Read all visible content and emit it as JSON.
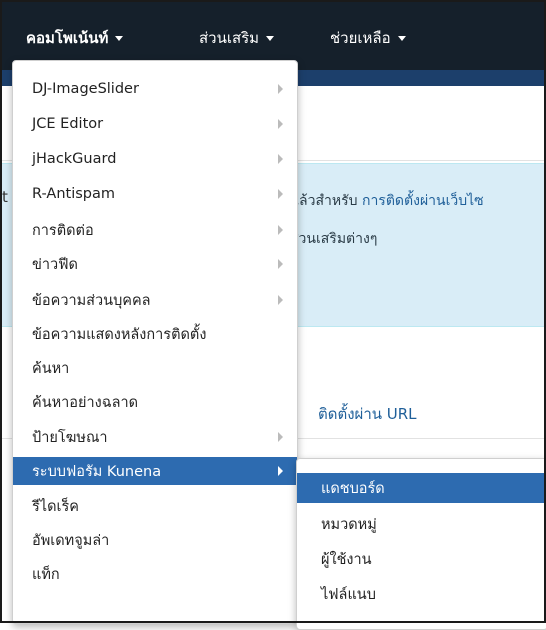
{
  "navbar": {
    "items": [
      {
        "label": "คอมโพเน้นท์"
      },
      {
        "label": "ส่วนเสริม"
      },
      {
        "label": "ช่วยเหลือ"
      }
    ]
  },
  "background": {
    "info_text_1": "แล้วสำหรับ",
    "info_link_1": "การติดตั้งผ่านเว็บไซ",
    "info_text_2": "ส่วนเสริมต่างๆ",
    "url_tab": "ติดตั้งผ่าน URL"
  },
  "menu": {
    "items": [
      {
        "label": "DJ-ImageSlider"
      },
      {
        "label": "JCE Editor"
      },
      {
        "label": "jHackGuard"
      },
      {
        "label": "R-Antispam"
      },
      {
        "label": "การติดต่อ"
      },
      {
        "label": "ข่าวฟีด"
      },
      {
        "label": "ข้อความส่วนบุคคล"
      },
      {
        "label": "ข้อความแสดงหลังการติดตั้ง"
      },
      {
        "label": "ค้นหา"
      },
      {
        "label": "ค้นหาอย่างฉลาด"
      },
      {
        "label": "ป้ายโฆษณา"
      },
      {
        "label": "ระบบฟอรัม Kunena"
      },
      {
        "label": "รีไดเร็ค"
      },
      {
        "label": "อัพเดทจูมล่า"
      },
      {
        "label": "แท็ก"
      }
    ]
  },
  "submenu": {
    "items": [
      {
        "label": "แดชบอร์ด"
      },
      {
        "label": "หมวดหมู่"
      },
      {
        "label": "ผู้ใช้งาน"
      },
      {
        "label": "ไฟล์แนบ"
      }
    ]
  }
}
